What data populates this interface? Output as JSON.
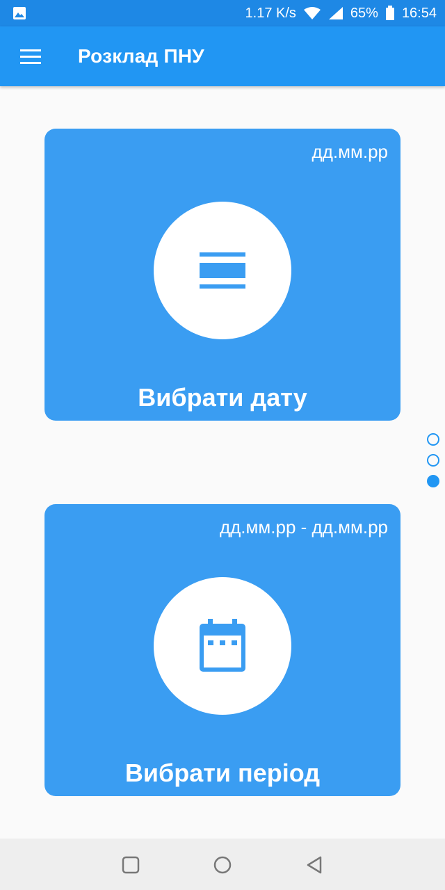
{
  "status_bar": {
    "net_speed": "1.17 K/s",
    "battery": "65%",
    "time": "16:54",
    "icons": [
      "gallery-icon",
      "wifi-icon",
      "signal-icon",
      "battery-icon"
    ]
  },
  "app_bar": {
    "title": "Розклад ПНУ",
    "menu_icon": "hamburger-menu-icon",
    "background": "#2196f3"
  },
  "cards": [
    {
      "hint": "дд.мм.рр",
      "label": "Вибрати дату",
      "icon": "view-day-icon"
    },
    {
      "hint": "дд.мм.рр - дд.мм.рр",
      "label": "Вибрати період",
      "icon": "calendar-icon"
    }
  ],
  "pager": {
    "total": 3,
    "active_index": 3
  },
  "colors": {
    "accent": "#2196f3",
    "card": "#3a9df2",
    "status_bar": "#1e88e5",
    "background": "#fafafa"
  },
  "nav_bar": {
    "buttons": [
      "recents-icon",
      "home-icon",
      "back-icon"
    ]
  }
}
